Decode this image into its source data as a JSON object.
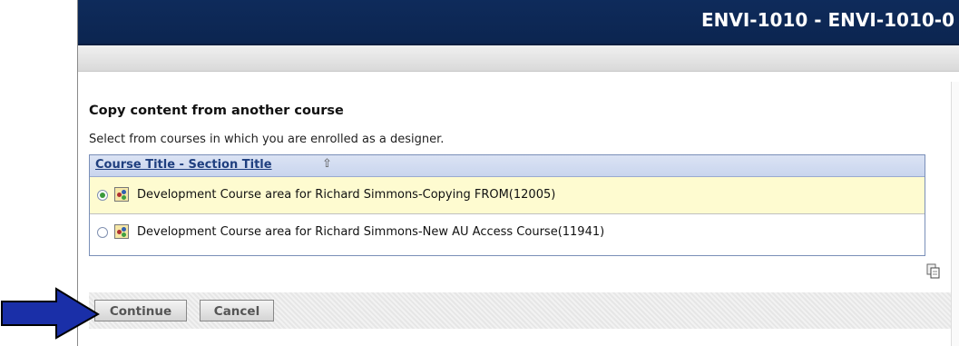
{
  "header": {
    "title": "ENVI-1010 - ENVI-1010-0"
  },
  "page": {
    "heading": "Copy content from another course",
    "description": "Select from courses in which you are enrolled as a designer."
  },
  "table": {
    "column_header": "Course Title - Section Title",
    "sort_icon": "sort-ascending-arrow-icon",
    "rows": [
      {
        "label": "Development Course area for Richard Simmons-Copying FROM(12005)",
        "selected": true
      },
      {
        "label": "Development Course area for Richard Simmons-New AU Access Course(11941)",
        "selected": false
      }
    ]
  },
  "buttons": {
    "continue_label": "Continue",
    "cancel_label": "Cancel"
  },
  "colors": {
    "header_bg": "#0e2b5b",
    "selected_row_bg": "#fefbd0",
    "arrow": "#1a2fa8"
  }
}
